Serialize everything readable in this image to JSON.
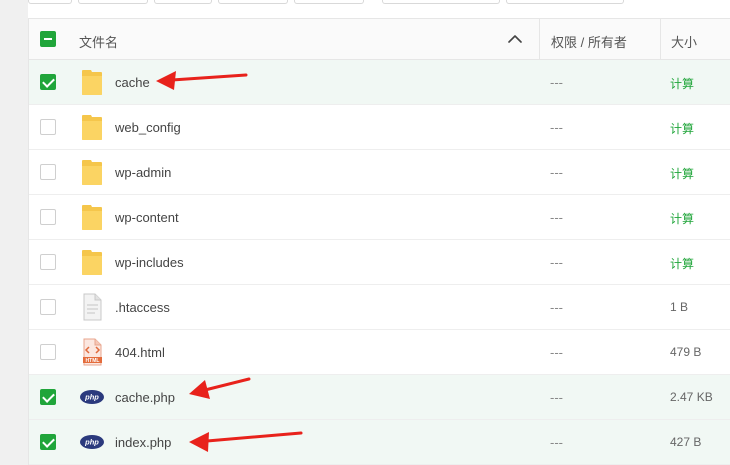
{
  "colors": {
    "accent": "#20a53a",
    "selected_row": "#f1f8f4",
    "annotation_arrow": "#e8221b"
  },
  "table": {
    "select_all_state": "partial",
    "headers": {
      "name": "文件名",
      "permission": "权限 / 所有者",
      "size": "大小"
    },
    "sort_icon": "chevron-up-icon",
    "rows": [
      {
        "name": "cache",
        "type": "folder",
        "icon": "folder-icon",
        "permission": "---",
        "size": "计算",
        "selected": true
      },
      {
        "name": "web_config",
        "type": "folder",
        "icon": "folder-icon",
        "permission": "---",
        "size": "计算",
        "selected": false
      },
      {
        "name": "wp-admin",
        "type": "folder",
        "icon": "folder-icon",
        "permission": "---",
        "size": "计算",
        "selected": false
      },
      {
        "name": "wp-content",
        "type": "folder",
        "icon": "folder-icon",
        "permission": "---",
        "size": "计算",
        "selected": false
      },
      {
        "name": "wp-includes",
        "type": "folder",
        "icon": "folder-icon",
        "permission": "---",
        "size": "计算",
        "selected": false
      },
      {
        "name": ".htaccess",
        "type": "file",
        "icon": "text-file-icon",
        "permission": "---",
        "size": "1 B",
        "selected": false
      },
      {
        "name": "404.html",
        "type": "html",
        "icon": "html-file-icon",
        "permission": "---",
        "size": "479 B",
        "selected": false
      },
      {
        "name": "cache.php",
        "type": "php",
        "icon": "php-file-icon",
        "permission": "---",
        "size": "2.47 KB",
        "selected": true
      },
      {
        "name": "index.php",
        "type": "php",
        "icon": "php-file-icon",
        "permission": "---",
        "size": "427 B",
        "selected": true
      }
    ]
  },
  "icon_text": {
    "html": "HTML",
    "php": "php"
  }
}
